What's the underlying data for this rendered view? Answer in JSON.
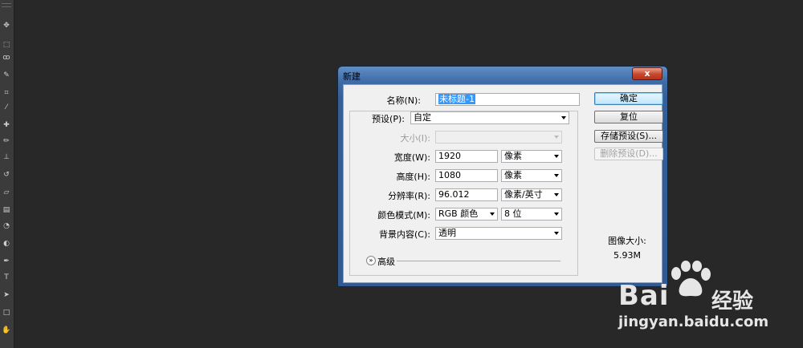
{
  "dialog": {
    "title": "新建",
    "close": "x",
    "fields": {
      "name": {
        "label": "名称(N):",
        "value": "未标题-1"
      },
      "preset": {
        "label": "预设(P):",
        "value": "自定"
      },
      "size": {
        "label": "大小(I):",
        "value": ""
      },
      "width": {
        "label": "宽度(W):",
        "value": "1920",
        "unit": "像素"
      },
      "height": {
        "label": "高度(H):",
        "value": "1080",
        "unit": "像素"
      },
      "resolution": {
        "label": "分辨率(R):",
        "value": "96.012",
        "unit": "像素/英寸"
      },
      "color_mode": {
        "label": "颜色模式(M):",
        "value": "RGB 颜色",
        "depth": "8 位"
      },
      "background": {
        "label": "背景内容(C):",
        "value": "透明"
      }
    },
    "advanced_label": "高级",
    "buttons": {
      "ok": "确定",
      "reset": "复位",
      "save_preset": "存储预设(S)...",
      "delete_preset": "删除预设(D)..."
    },
    "image_size": {
      "label": "图像大小:",
      "value": "5.93M"
    }
  },
  "watermark": {
    "brand": "Bai",
    "brand2": "经验",
    "url": "jingyan.baidu.com"
  }
}
